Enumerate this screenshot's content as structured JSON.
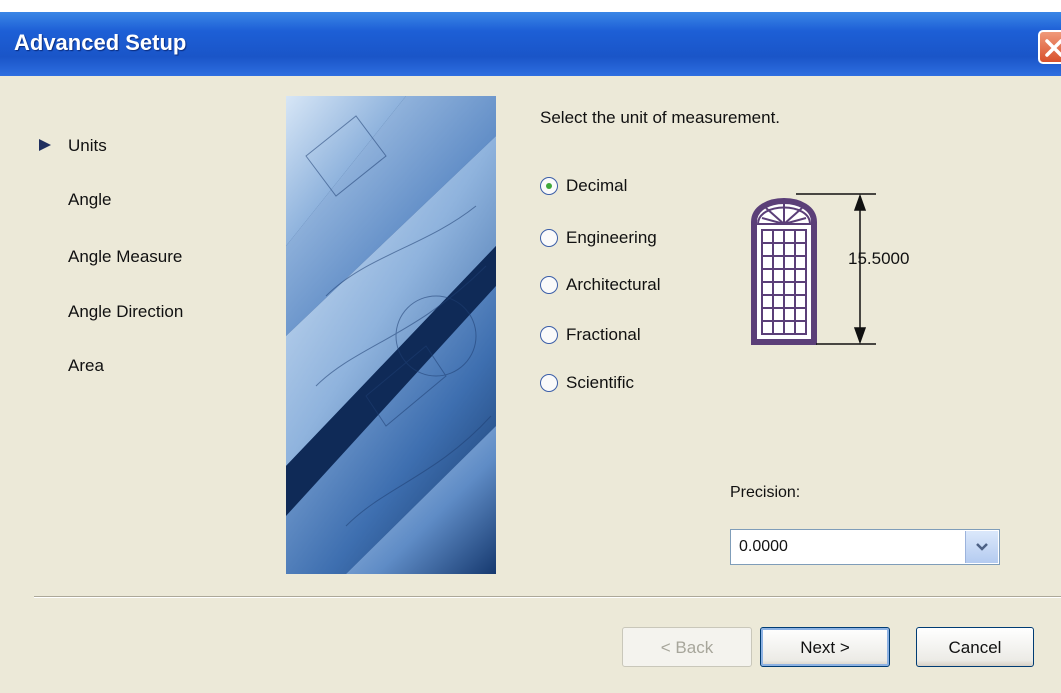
{
  "window": {
    "title": "Advanced Setup"
  },
  "nav": {
    "items": [
      {
        "label": "Units",
        "active": true
      },
      {
        "label": "Angle",
        "active": false
      },
      {
        "label": "Angle Measure",
        "active": false
      },
      {
        "label": "Angle Direction",
        "active": false
      },
      {
        "label": "Area",
        "active": false
      }
    ]
  },
  "units": {
    "prompt": "Select the unit of measurement.",
    "options": [
      {
        "label": "Decimal",
        "selected": true
      },
      {
        "label": "Engineering",
        "selected": false
      },
      {
        "label": "Architectural",
        "selected": false
      },
      {
        "label": "Fractional",
        "selected": false
      },
      {
        "label": "Scientific",
        "selected": false
      }
    ],
    "preview_value": "15.5000"
  },
  "precision": {
    "label": "Precision:",
    "value": "0.0000"
  },
  "buttons": {
    "back": "< Back",
    "next": "Next >",
    "cancel": "Cancel"
  },
  "colors": {
    "title_bar": "#1d5fd6",
    "dialog_bg": "#ece9d8",
    "window_frame": "#5b3f78",
    "radio_dot": "#3fa83a"
  },
  "icons": {
    "close": "close-icon",
    "nav_arrow": "play-arrow-icon",
    "dropdown": "chevron-down-icon"
  }
}
